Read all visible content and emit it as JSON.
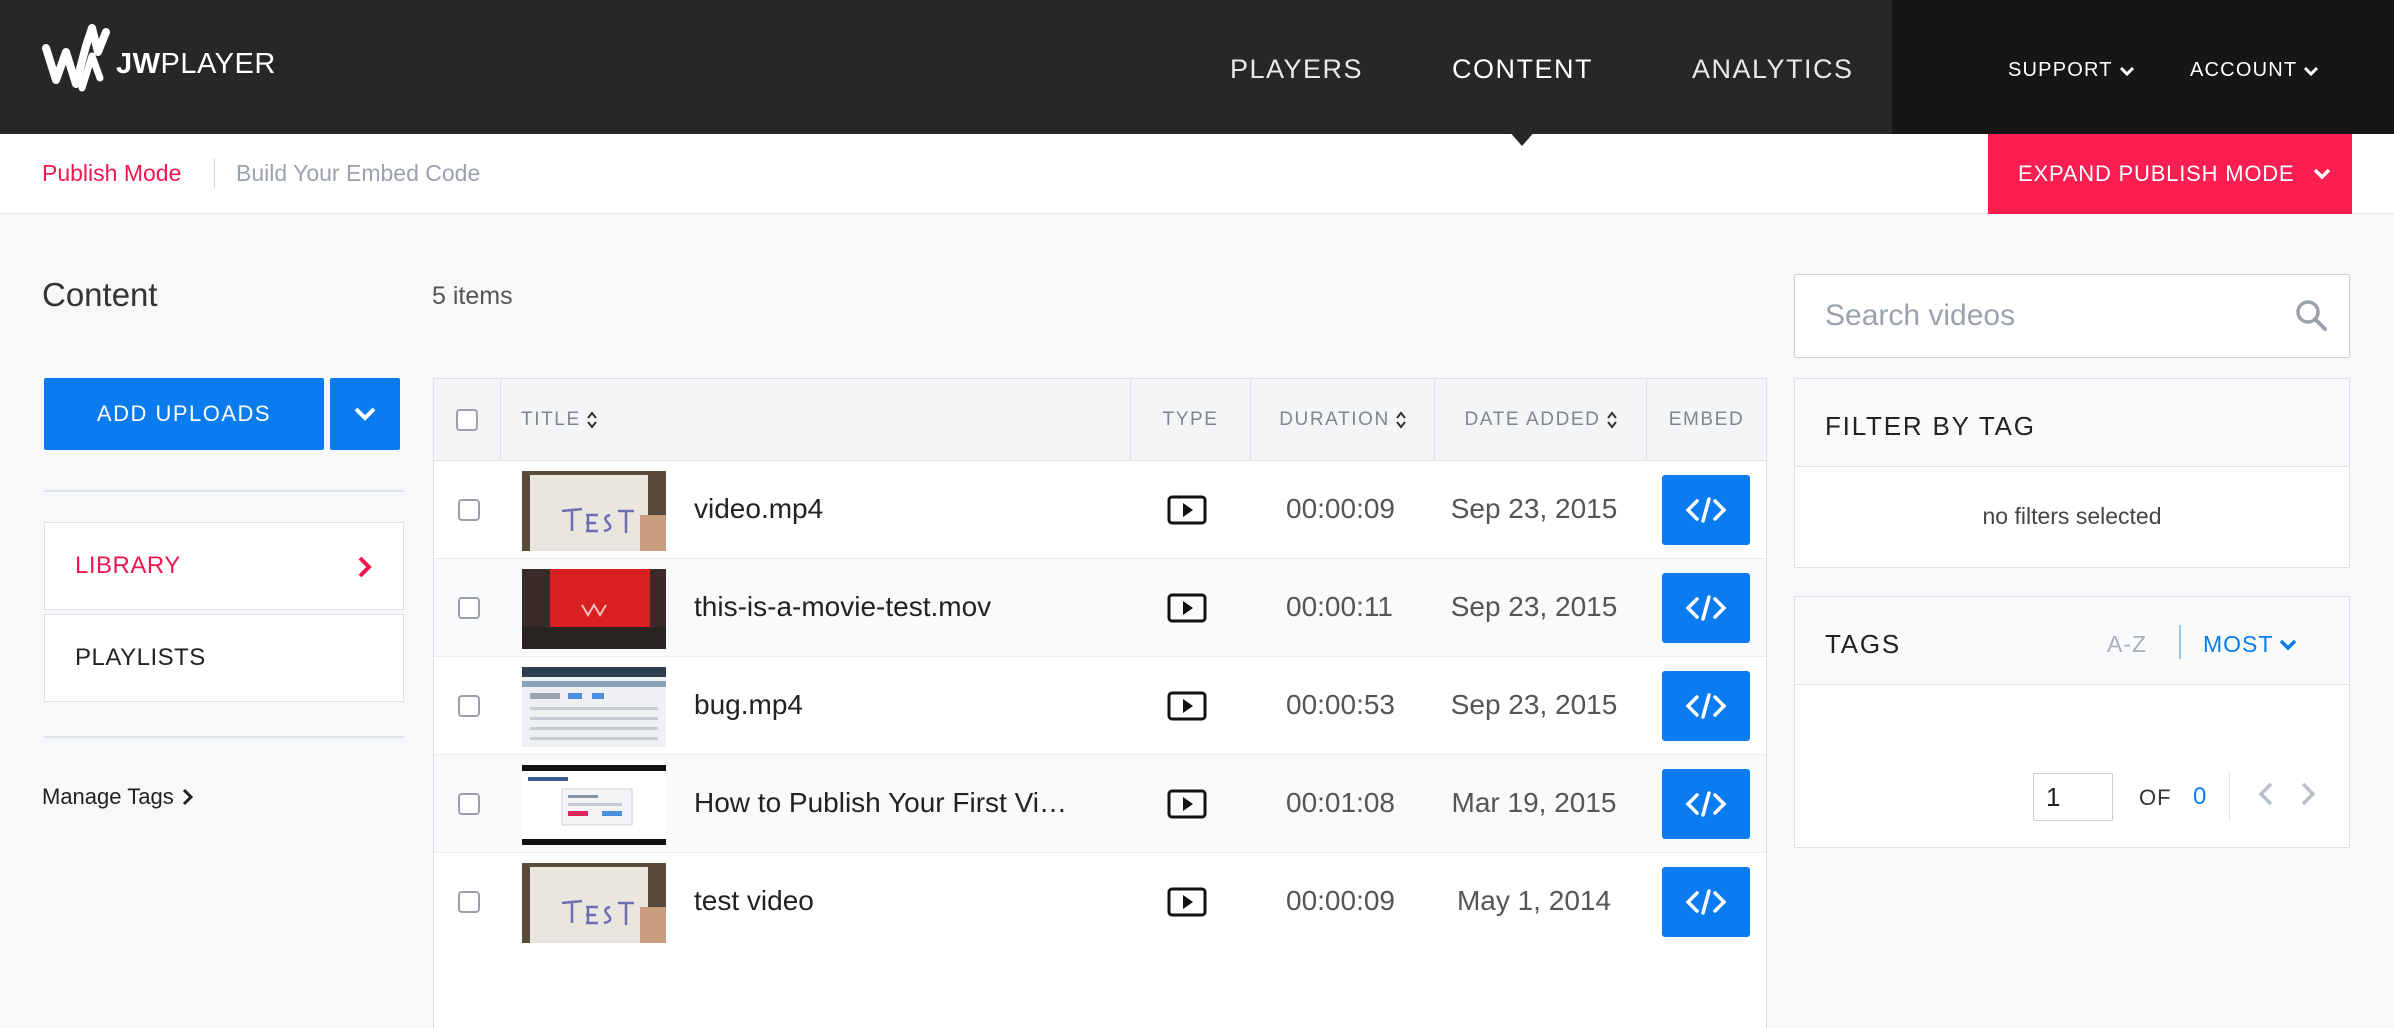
{
  "brand": {
    "logo_text_bold": "JW",
    "logo_text_rest": "PLAYER"
  },
  "nav": {
    "main": [
      {
        "label": "PLAYERS",
        "active": false
      },
      {
        "label": "CONTENT",
        "active": true
      },
      {
        "label": "ANALYTICS",
        "active": false
      }
    ],
    "support": "SUPPORT",
    "account": "ACCOUNT"
  },
  "subnav": {
    "publish_mode": "Publish Mode",
    "build_embed": "Build Your Embed Code",
    "expand_button": "EXPAND PUBLISH MODE"
  },
  "sidebar": {
    "title": "Content",
    "add_uploads": "ADD UPLOADS",
    "items": [
      {
        "label": "LIBRARY",
        "active": true
      },
      {
        "label": "PLAYLISTS",
        "active": false
      }
    ],
    "manage_tags": "Manage Tags"
  },
  "content": {
    "item_count": "5 items",
    "columns": {
      "title": "TITLE",
      "type": "TYPE",
      "duration": "DURATION",
      "date_added": "DATE ADDED",
      "embed": "EMBED"
    },
    "rows": [
      {
        "title": "video.mp4",
        "type": "video",
        "duration": "00:00:09",
        "date": "Sep 23, 2015",
        "thumb": "paper-test"
      },
      {
        "title": "this-is-a-movie-test.mov",
        "type": "video",
        "duration": "00:00:11",
        "date": "Sep 23, 2015",
        "thumb": "red-screen"
      },
      {
        "title": "bug.mp4",
        "type": "video",
        "duration": "00:00:53",
        "date": "Sep 23, 2015",
        "thumb": "screen-capture"
      },
      {
        "title": "How to Publish Your First Vi…",
        "type": "video",
        "duration": "00:01:08",
        "date": "Mar 19, 2015",
        "thumb": "tutorial-screen"
      },
      {
        "title": "test video",
        "type": "video",
        "duration": "00:00:09",
        "date": "May 1, 2014",
        "thumb": "paper-test"
      }
    ]
  },
  "search": {
    "placeholder": "Search videos"
  },
  "filter": {
    "title": "FILTER BY TAG",
    "empty_text": "no filters selected"
  },
  "tags": {
    "title": "TAGS",
    "sort_az": "A-Z",
    "sort_most": "MOST",
    "page_value": "1",
    "of_label": "OF",
    "total_pages": "0"
  },
  "colors": {
    "nav_bg": "#272727",
    "accent_pink": "#fc1e50",
    "accent_blue": "#0a7cf0"
  }
}
